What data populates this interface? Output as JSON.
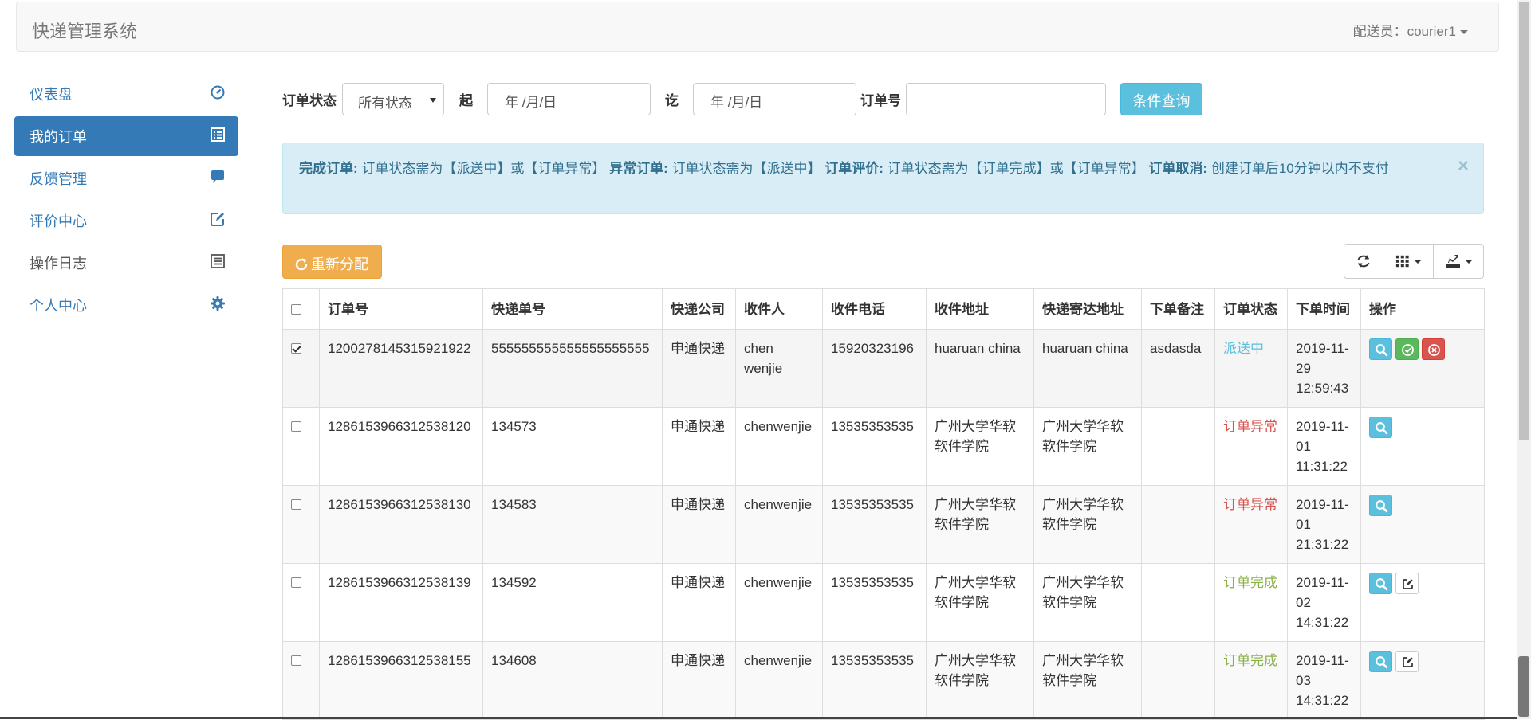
{
  "navbar": {
    "brand": "快递管理系统",
    "user_label": "配送员：courier1"
  },
  "sidebar": {
    "items": [
      {
        "label": "仪表盘",
        "icon": "dashboard-icon"
      },
      {
        "label": "我的订单",
        "icon": "list-alt-icon"
      },
      {
        "label": "反馈管理",
        "icon": "comment-icon"
      },
      {
        "label": "评价中心",
        "icon": "edit-icon"
      },
      {
        "label": "操作日志",
        "icon": "list-icon"
      },
      {
        "label": "个人中心",
        "icon": "cog-icon"
      }
    ],
    "active_index": 1
  },
  "filter": {
    "status_label": "订单状态",
    "status_value": "所有状态",
    "from_label": "起",
    "from_placeholder": "年 /月/日",
    "to_label": "讫",
    "to_placeholder": "年 /月/日",
    "order_no_label": "订单号",
    "order_no_value": "",
    "search_button": "条件查询"
  },
  "alert": {
    "t1": "完成订单:",
    "d1": "订单状态需为【派送中】或【订单异常】",
    "t2": "异常订单:",
    "d2": "订单状态需为【派送中】",
    "t3": "订单评价:",
    "d3": "订单状态需为【订单完成】或【订单异常】",
    "t4": "订单取消:",
    "d4": "创建订单后10分钟以内不支付",
    "close": "×"
  },
  "toolbar": {
    "reassign_label": "重新分配",
    "refresh_icon": "refresh-icon",
    "columns_icon": "columns-grid-icon",
    "export_icon": "export-icon"
  },
  "table": {
    "headers": [
      "订单号",
      "快递单号",
      "快递公司",
      "收件人",
      "收件电话",
      "收件地址",
      "快递寄达地址",
      "下单备注",
      "订单状态",
      "下单时间",
      "操作"
    ],
    "rows": [
      {
        "checked": true,
        "order_no": "1200278145315921922",
        "tracking_no": "555555555555555555555",
        "company": "申通快递",
        "recipient": "chen wenjie",
        "phone": "15920323196",
        "address": "huaruan china",
        "dest": "huaruan china",
        "remark": "asdasda",
        "status": "派送中",
        "status_color": "#5bc0de",
        "time": "2019-11-29 12:59:43",
        "actions": [
          "view",
          "complete",
          "exception"
        ]
      },
      {
        "checked": false,
        "order_no": "1286153966312538120",
        "tracking_no": "134573",
        "company": "申通快递",
        "recipient": "chenwenjie",
        "phone": "13535353535",
        "address": "广州大学华软软件学院",
        "dest": "广州大学华软软件学院",
        "remark": "",
        "status": "订单异常",
        "status_color": "#d9534f",
        "time": "2019-11-01 11:31:22",
        "actions": [
          "view"
        ]
      },
      {
        "checked": false,
        "order_no": "1286153966312538130",
        "tracking_no": "134583",
        "company": "申通快递",
        "recipient": "chenwenjie",
        "phone": "13535353535",
        "address": "广州大学华软软件学院",
        "dest": "广州大学华软软件学院",
        "remark": "",
        "status": "订单异常",
        "status_color": "#d9534f",
        "time": "2019-11-01 21:31:22",
        "actions": [
          "view"
        ]
      },
      {
        "checked": false,
        "order_no": "1286153966312538139",
        "tracking_no": "134592",
        "company": "申通快递",
        "recipient": "chenwenjie",
        "phone": "13535353535",
        "address": "广州大学华软软件学院",
        "dest": "广州大学华软软件学院",
        "remark": "",
        "status": "订单完成",
        "status_color": "#8ab24a",
        "time": "2019-11-02 14:31:22",
        "actions": [
          "view",
          "evaluate"
        ]
      },
      {
        "checked": false,
        "order_no": "1286153966312538155",
        "tracking_no": "134608",
        "company": "申通快递",
        "recipient": "chenwenjie",
        "phone": "13535353535",
        "address": "广州大学华软软件学院",
        "dest": "广州大学华软软件学院",
        "remark": "",
        "status": "订单完成",
        "status_color": "#8ab24a",
        "time": "2019-11-03 14:31:22",
        "actions": [
          "view",
          "evaluate"
        ]
      }
    ]
  }
}
